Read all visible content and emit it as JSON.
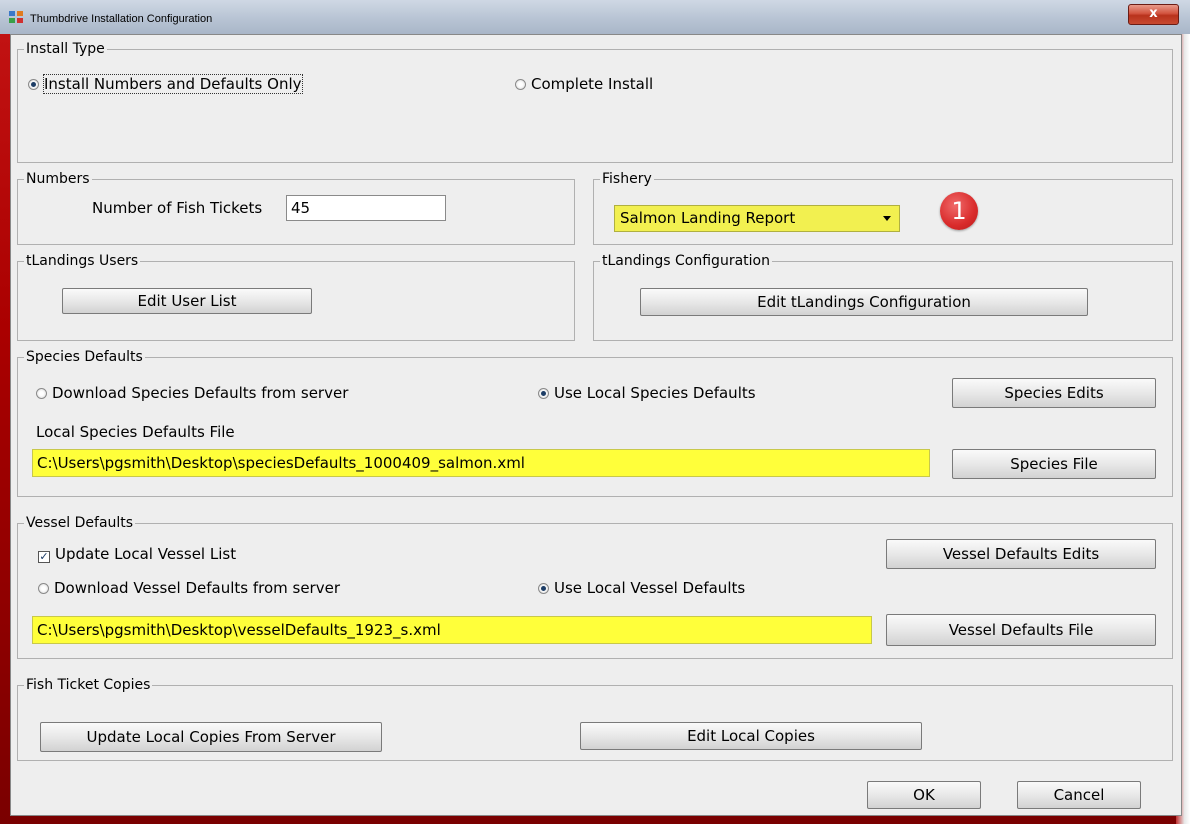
{
  "window": {
    "title": "Thumbdrive Installation Configuration",
    "close_label": "x"
  },
  "install_type": {
    "legend": "Install Type",
    "option_numbers": "Install Numbers and Defaults Only",
    "option_complete": "Complete Install",
    "selected": "option_numbers"
  },
  "numbers": {
    "legend": "Numbers",
    "fish_tickets_label": "Number of Fish Tickets",
    "fish_tickets_value": "45"
  },
  "fishery": {
    "legend": "Fishery",
    "selected": "Salmon Landing Report",
    "badge": "1"
  },
  "users": {
    "legend": "tLandings Users",
    "edit_button": "Edit User List"
  },
  "config": {
    "legend": "tLandings Configuration",
    "edit_button": "Edit tLandings Configuration"
  },
  "species": {
    "legend": "Species Defaults",
    "option_download": "Download Species Defaults from server",
    "option_local": "Use Local Species Defaults",
    "selected": "option_local",
    "edits_button": "Species Edits",
    "file_label": "Local Species Defaults File",
    "file_value": "C:\\Users\\pgsmith\\Desktop\\speciesDefaults_1000409_salmon.xml",
    "file_button": "Species File"
  },
  "vessel": {
    "legend": "Vessel Defaults",
    "update_label": "Update Local Vessel List",
    "update_checked": true,
    "option_download": "Download Vessel Defaults from server",
    "option_local": "Use Local Vessel Defaults",
    "selected": "option_local",
    "edits_button": "Vessel Defaults Edits",
    "file_value": "C:\\Users\\pgsmith\\Desktop\\vesselDefaults_1923_s.xml",
    "file_button": "Vessel Defaults File"
  },
  "copies": {
    "legend": "Fish Ticket Copies",
    "update_button": "Update Local Copies From Server",
    "edit_button": "Edit Local Copies"
  },
  "footer": {
    "ok": "OK",
    "cancel": "Cancel"
  }
}
